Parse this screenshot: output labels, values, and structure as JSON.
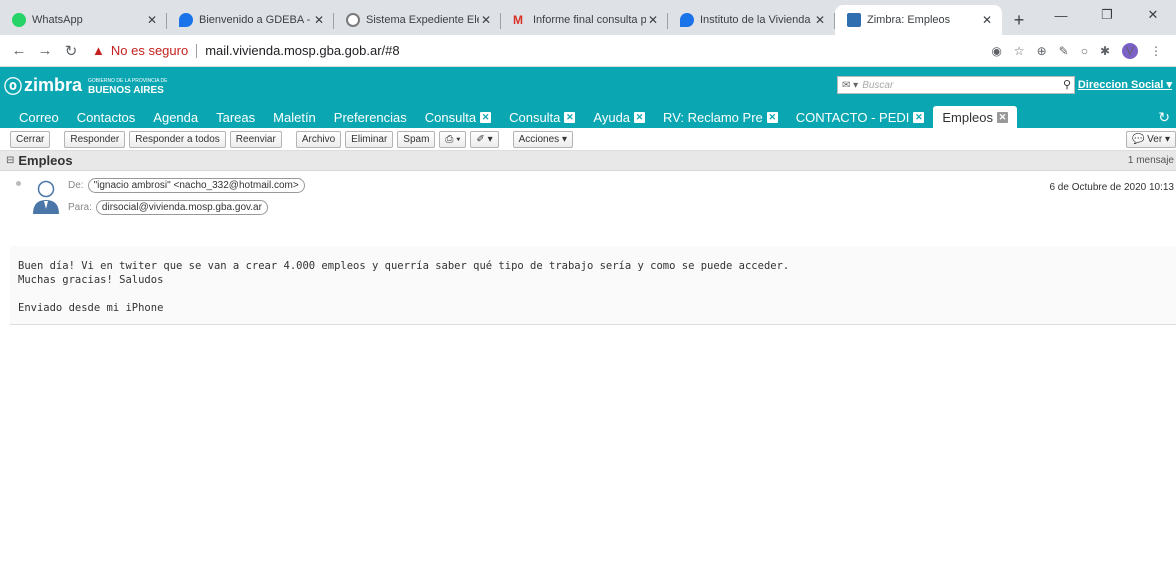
{
  "browser": {
    "tabs": [
      {
        "label": "WhatsApp",
        "icon": "whatsapp-icon"
      },
      {
        "label": "Bienvenido a GDEBA - C",
        "icon": "gdeba-icon"
      },
      {
        "label": "Sistema Expediente Ele",
        "icon": "expediente-icon"
      },
      {
        "label": "Informe final consulta p",
        "icon": "gmail-icon"
      },
      {
        "label": "Instituto de la Vivienda",
        "icon": "gdeba-icon"
      },
      {
        "label": "Zimbra: Empleos",
        "icon": "zimbra-icon"
      }
    ],
    "security_label": "No es seguro",
    "url": "mail.vivienda.mosp.gba.gob.ar/#8",
    "profile_initial": "V"
  },
  "zimbra": {
    "logo_text": "zimbra",
    "brand_small": "GOBIERNO DE LA PROVINCIA DE",
    "brand": "BUENOS AIRES",
    "search_placeholder": "Buscar",
    "user": "Direccion Social",
    "app_tabs": [
      {
        "label": "Correo",
        "closable": false
      },
      {
        "label": "Contactos",
        "closable": false
      },
      {
        "label": "Agenda",
        "closable": false
      },
      {
        "label": "Tareas",
        "closable": false
      },
      {
        "label": "Maletín",
        "closable": false
      },
      {
        "label": "Preferencias",
        "closable": false
      },
      {
        "label": "Consulta",
        "closable": true
      },
      {
        "label": "Consulta",
        "closable": true
      },
      {
        "label": "Ayuda",
        "closable": true
      },
      {
        "label": "RV: Reclamo Pre",
        "closable": true
      },
      {
        "label": "CONTACTO - PEDI",
        "closable": true
      },
      {
        "label": "Empleos",
        "closable": true,
        "active": true
      }
    ],
    "toolbar": {
      "cerrar": "Cerrar",
      "responder": "Responder",
      "responder_todos": "Responder a todos",
      "reenviar": "Reenviar",
      "archivo": "Archivo",
      "eliminar": "Eliminar",
      "spam": "Spam",
      "acciones": "Acciones",
      "ver": "Ver"
    },
    "conversation": {
      "subject": "Empleos",
      "count": "1 mensaje"
    },
    "message": {
      "from_label": "De:",
      "from": "\"ignacio ambrosi\" <nacho_332@hotmail.com>",
      "to_label": "Para:",
      "to": "dirsocial@vivienda.mosp.gba.gov.ar",
      "date": "6 de Octubre de 2020 10:13",
      "body_line1": "Buen día! Vi en twiter que se van a crear 4.000 empleos y querría saber qué tipo de trabajo sería y como se puede acceder.",
      "body_line2": "Muchas gracias! Saludos",
      "body_line3": "Enviado desde mi iPhone"
    }
  }
}
